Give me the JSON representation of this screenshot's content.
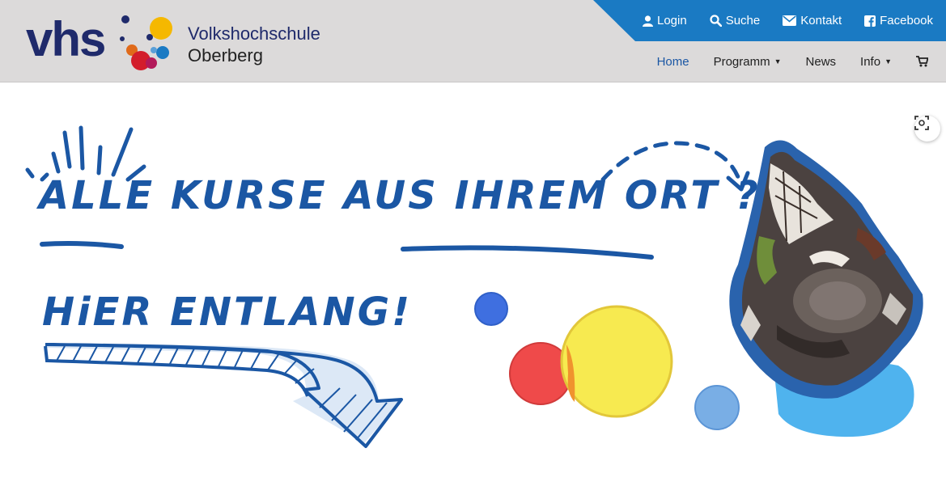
{
  "brand": {
    "logo_text": "vhs",
    "line1": "Volkshochschule",
    "line2": "Oberberg",
    "colors": {
      "navy": "#1f2a6b",
      "blue": "#1b57a4",
      "topbar": "#1a7ac3"
    }
  },
  "top_links": [
    {
      "icon": "user-icon",
      "label": "Login"
    },
    {
      "icon": "search-icon",
      "label": "Suche"
    },
    {
      "icon": "envelope-icon",
      "label": "Kontakt"
    },
    {
      "icon": "facebook-icon",
      "label": "Facebook"
    }
  ],
  "main_nav": [
    {
      "label": "Home",
      "active": true
    },
    {
      "label": "Programm",
      "dropdown": true
    },
    {
      "label": "News"
    },
    {
      "label": "Info",
      "dropdown": true
    }
  ],
  "cart": {
    "icon": "cart-icon"
  },
  "hero": {
    "headline_a": "ALLE KURSE AUS ",
    "headline_b": "IHREM ORT",
    "headline_c": " ?",
    "subhead": "HiER ENTLANG!"
  },
  "expand_button": {
    "icon": "expand-icon"
  }
}
